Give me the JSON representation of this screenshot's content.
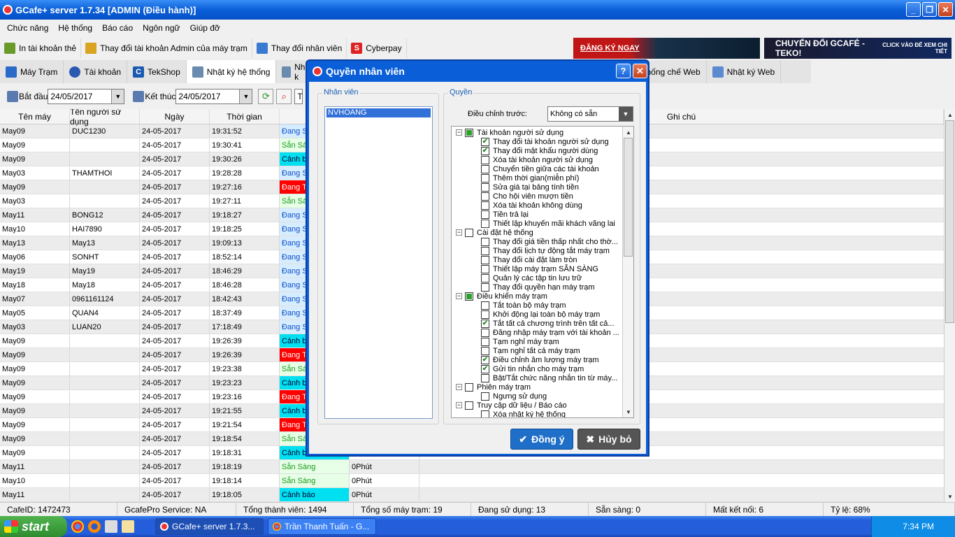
{
  "window": {
    "title": "GCafe+ server 1.7.34 [ADMIN (Điều hành)]"
  },
  "menu": [
    "Chức năng",
    "Hệ thống",
    "Báo cáo",
    "Ngôn ngữ",
    "Giúp đỡ"
  ],
  "toolbar": [
    "In tài khoản thẻ",
    "Thay đổi tài khoản Admin của máy trạm",
    "Thay đổi nhân viên",
    "Cyberpay"
  ],
  "banners": {
    "left": "ĐĂNG KÝ NGAY",
    "right": "CHUYỂN ĐỔI  GCAFÉ - TEKO!",
    "right_small": "CLICK VÀO ĐỂ XEM CHI TIẾT"
  },
  "tabs": [
    "Máy Trạm",
    "Tài khoản",
    "TekShop",
    "Nhật ký hệ thống",
    "Nhật k",
    "Khống chế Web",
    "Nhật ký Web"
  ],
  "filter": {
    "start_label": "Bắt đầu",
    "start_value": "24/05/2017",
    "end_label": "Kết thúc",
    "end_value": "24/05/2017",
    "next_field": "T"
  },
  "grid": {
    "headers": [
      "Tên máy",
      "Tên người sử dụng",
      "Ngày",
      "Thời gian",
      "Tì",
      "",
      "Ghi chú"
    ],
    "rows": [
      [
        "May09",
        "DUC1230",
        "24-05-2017",
        "19:31:52",
        "Đang S",
        "dang",
        ""
      ],
      [
        "May09",
        "",
        "24-05-2017",
        "19:30:41",
        "Sẵn Sà",
        "san",
        ""
      ],
      [
        "May09",
        "",
        "24-05-2017",
        "19:30:26",
        "Cảnh b",
        "canh",
        ""
      ],
      [
        "May03",
        "THAMTHOI",
        "24-05-2017",
        "19:28:28",
        "Đang S",
        "dang",
        ""
      ],
      [
        "May09",
        "",
        "24-05-2017",
        "19:27:16",
        "Đang T",
        "dangt",
        ""
      ],
      [
        "May03",
        "",
        "24-05-2017",
        "19:27:11",
        "Sẵn Sà",
        "san",
        ""
      ],
      [
        "May11",
        "BONG12",
        "24-05-2017",
        "19:18:27",
        "Đang S",
        "dang",
        ""
      ],
      [
        "May10",
        "HAI7890",
        "24-05-2017",
        "19:18:25",
        "Đang S",
        "dang",
        ""
      ],
      [
        "May13",
        "May13",
        "24-05-2017",
        "19:09:13",
        "Đang S",
        "dang",
        ""
      ],
      [
        "May06",
        "SONHT",
        "24-05-2017",
        "18:52:14",
        "Đang S",
        "dang",
        ""
      ],
      [
        "May19",
        "May19",
        "24-05-2017",
        "18:46:29",
        "Đang S",
        "dang",
        ""
      ],
      [
        "May18",
        "May18",
        "24-05-2017",
        "18:46:28",
        "Đang S",
        "dang",
        ""
      ],
      [
        "May07",
        "0961161124",
        "24-05-2017",
        "18:42:43",
        "Đang S",
        "dang",
        ""
      ],
      [
        "May05",
        "QUAN4",
        "24-05-2017",
        "18:37:49",
        "Đang S",
        "dang",
        ""
      ],
      [
        "May03",
        "LUAN20",
        "24-05-2017",
        "17:18:49",
        "Đang S",
        "dang",
        ""
      ],
      [
        "May09",
        "",
        "24-05-2017",
        "19:26:39",
        "Cảnh b",
        "canh",
        ""
      ],
      [
        "May09",
        "",
        "24-05-2017",
        "19:26:39",
        "Đang T",
        "dangt",
        ""
      ],
      [
        "May09",
        "",
        "24-05-2017",
        "19:23:38",
        "Sẵn Sà",
        "san",
        ""
      ],
      [
        "May09",
        "",
        "24-05-2017",
        "19:23:23",
        "Cảnh b",
        "canh",
        ""
      ],
      [
        "May09",
        "",
        "24-05-2017",
        "19:23:16",
        "Đang T",
        "dangt",
        ""
      ],
      [
        "May09",
        "",
        "24-05-2017",
        "19:21:55",
        "Cảnh b",
        "canh",
        ""
      ],
      [
        "May09",
        "",
        "24-05-2017",
        "19:21:54",
        "Đang T",
        "dangt",
        ""
      ],
      [
        "May09",
        "",
        "24-05-2017",
        "19:18:54",
        "Sẵn Sà",
        "san",
        ""
      ],
      [
        "May09",
        "",
        "24-05-2017",
        "19:18:31",
        "Cảnh b",
        "canh",
        ""
      ],
      [
        "May11",
        "",
        "24-05-2017",
        "19:18:19",
        "Sẵn Sàng",
        "san",
        "0Phút"
      ],
      [
        "May10",
        "",
        "24-05-2017",
        "19:18:14",
        "Sẵn Sàng",
        "san",
        "0Phút"
      ],
      [
        "May11",
        "",
        "24-05-2017",
        "19:18:05",
        "Cảnh báo",
        "canh",
        "0Phút"
      ]
    ]
  },
  "status": [
    "CafeID: 1472473",
    "GcafePro Service: NA",
    "Tổng thành viên: 1494",
    "Tổng số máy trạm: 19",
    "Đang sử dụng: 13",
    "Sẵn sàng: 0",
    "Mất kết nối: 6",
    "Tỷ lệ: 68%"
  ],
  "taskbar": {
    "start": "start",
    "items": [
      "GCafe+ server 1.7.3...",
      "Trần Thanh Tuấn - G..."
    ],
    "clock": "7:34 PM"
  },
  "dialog": {
    "title": "Quyền nhân viên",
    "staff_group": "Nhân viên",
    "staff": [
      "NVHOANG"
    ],
    "perm_group": "Quyền",
    "adjust_label": "Điều chỉnh trước:",
    "adjust_value": "Không có sẵn",
    "tree": [
      {
        "t": "Tài khoản người sử dụng",
        "lvl": 0,
        "state": "part"
      },
      {
        "t": "Thay đổi tài khoản người sử dụng",
        "lvl": 1,
        "state": "on"
      },
      {
        "t": "Thay đổi mật khẩu người dùng",
        "lvl": 1,
        "state": "on"
      },
      {
        "t": "Xóa tài khoản người sử dụng",
        "lvl": 1,
        "state": "off"
      },
      {
        "t": "Chuyển tiền giữa các tài khoản",
        "lvl": 1,
        "state": "off"
      },
      {
        "t": "Thêm thời gian(miễn phí)",
        "lvl": 1,
        "state": "off"
      },
      {
        "t": "Sửa giá tại bảng tính tiền",
        "lvl": 1,
        "state": "off"
      },
      {
        "t": "Cho hội viên mượn tiền",
        "lvl": 1,
        "state": "off"
      },
      {
        "t": "Xóa tài khoản không dùng",
        "lvl": 1,
        "state": "off"
      },
      {
        "t": "Tiền trả lại",
        "lvl": 1,
        "state": "off"
      },
      {
        "t": "Thiết lập khuyến mãi khách vãng lai",
        "lvl": 1,
        "state": "off"
      },
      {
        "t": "Cài đặt hệ thống",
        "lvl": 0,
        "state": "off"
      },
      {
        "t": "Thay đổi giá tiền thấp nhất cho thờ...",
        "lvl": 1,
        "state": "off"
      },
      {
        "t": "Thay đổi lịch tự động tắt máy trạm",
        "lvl": 1,
        "state": "off"
      },
      {
        "t": "Thay đổi cài đặt làm tròn",
        "lvl": 1,
        "state": "off"
      },
      {
        "t": "Thiết lập máy trạm SẴN SÀNG",
        "lvl": 1,
        "state": "off"
      },
      {
        "t": "Quản lý các tập tin lưu trữ",
        "lvl": 1,
        "state": "off"
      },
      {
        "t": "Thay đổi quyền hạn máy trạm",
        "lvl": 1,
        "state": "off"
      },
      {
        "t": "Điều khiển máy trạm",
        "lvl": 0,
        "state": "part"
      },
      {
        "t": "Tắt toàn bộ máy trạm",
        "lvl": 1,
        "state": "off"
      },
      {
        "t": "Khởi động lại toàn bộ máy trạm",
        "lvl": 1,
        "state": "off"
      },
      {
        "t": "Tắt tất cả chương trình  trên tất cả...",
        "lvl": 1,
        "state": "on"
      },
      {
        "t": "Đăng nhập máy trạm với tài khoản ...",
        "lvl": 1,
        "state": "off"
      },
      {
        "t": "Tạm nghỉ máy trạm",
        "lvl": 1,
        "state": "off"
      },
      {
        "t": "Tạm nghỉ tất cả máy trạm",
        "lvl": 1,
        "state": "off"
      },
      {
        "t": "Điều chỉnh âm lượng máy trạm",
        "lvl": 1,
        "state": "on"
      },
      {
        "t": "Gửi tin nhắn cho máy trạm",
        "lvl": 1,
        "state": "on"
      },
      {
        "t": "Bật/Tắt chức năng nhắn tin từ máy...",
        "lvl": 1,
        "state": "off"
      },
      {
        "t": "Phiên máy trạm",
        "lvl": 0,
        "state": "off"
      },
      {
        "t": "Ngưng sử dụng",
        "lvl": 1,
        "state": "off"
      },
      {
        "t": "Truy cập dữ liệu / Báo cáo",
        "lvl": 0,
        "state": "off"
      },
      {
        "t": "Xóa nhật ký hệ thống",
        "lvl": 1,
        "state": "off"
      }
    ],
    "ok": "Đồng ý",
    "cancel": "Hủy bỏ"
  }
}
